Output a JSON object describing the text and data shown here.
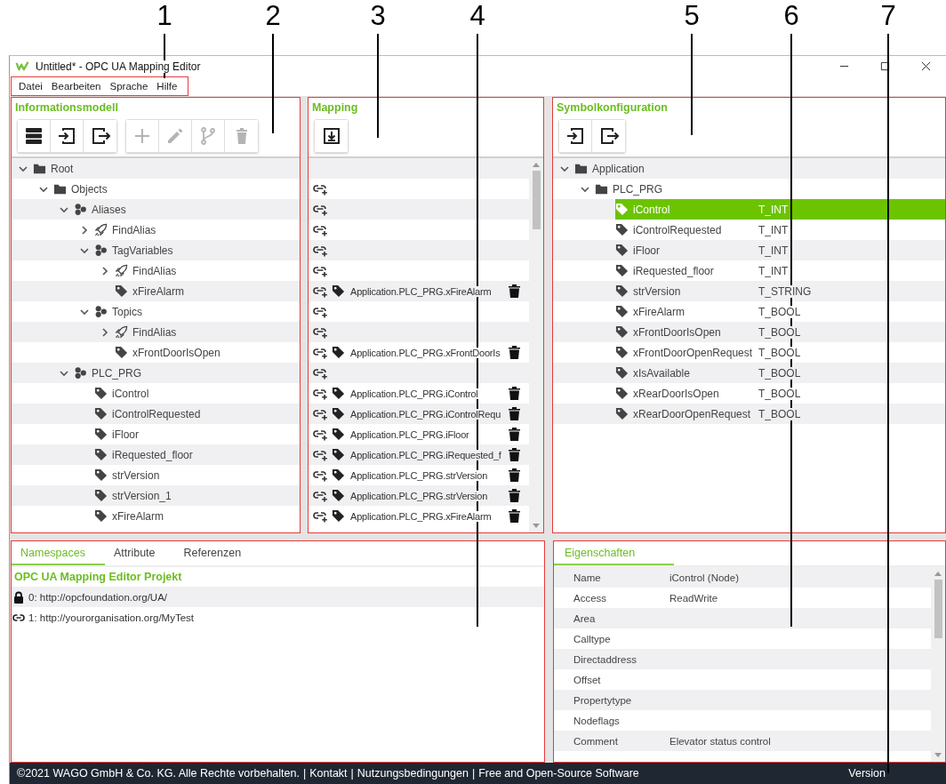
{
  "window": {
    "title": "Untitled* - OPC UA Mapping Editor"
  },
  "callouts": [
    {
      "number": "1"
    },
    {
      "number": "2"
    },
    {
      "number": "3"
    },
    {
      "number": "4"
    },
    {
      "number": "5"
    },
    {
      "number": "6"
    },
    {
      "number": "7"
    }
  ],
  "menu": [
    "Datei",
    "Bearbeiten",
    "Sprache",
    "Hilfe"
  ],
  "information_model": {
    "title": "Informationsmodell",
    "toolbar_groups": [
      [
        {
          "kind": "server",
          "disabled": false
        },
        {
          "kind": "import",
          "disabled": false
        },
        {
          "kind": "export",
          "disabled": false
        }
      ],
      [
        {
          "kind": "add",
          "disabled": true
        },
        {
          "kind": "edit",
          "disabled": true
        },
        {
          "kind": "branch",
          "disabled": true
        },
        {
          "kind": "delete",
          "disabled": true
        }
      ]
    ],
    "tree": [
      {
        "label": "Root",
        "kind": "folder",
        "expanded": true,
        "children": [
          {
            "label": "Objects",
            "kind": "folder",
            "expanded": true,
            "children": [
              {
                "label": "Aliases",
                "kind": "cluster",
                "expanded": true,
                "children": [
                  {
                    "label": "FindAlias",
                    "kind": "rocket",
                    "expanded": false
                  },
                  {
                    "label": "TagVariables",
                    "kind": "cluster",
                    "expanded": true,
                    "children": [
                      {
                        "label": "FindAlias",
                        "kind": "rocket",
                        "expanded": false
                      },
                      {
                        "label": "xFireAlarm",
                        "kind": "tag"
                      }
                    ]
                  },
                  {
                    "label": "Topics",
                    "kind": "cluster",
                    "expanded": true,
                    "children": [
                      {
                        "label": "FindAlias",
                        "kind": "rocket",
                        "expanded": false
                      },
                      {
                        "label": "xFrontDoorIsOpen",
                        "kind": "tag"
                      }
                    ]
                  }
                ]
              },
              {
                "label": "PLC_PRG",
                "kind": "cluster",
                "expanded": true,
                "children": [
                  {
                    "label": "iControl",
                    "kind": "tag"
                  },
                  {
                    "label": "iControlRequested",
                    "kind": "tag"
                  },
                  {
                    "label": "iFloor",
                    "kind": "tag"
                  },
                  {
                    "label": "iRequested_floor",
                    "kind": "tag"
                  },
                  {
                    "label": "strVersion",
                    "kind": "tag"
                  },
                  {
                    "label": "strVersion_1",
                    "kind": "tag"
                  },
                  {
                    "label": "xFireAlarm",
                    "kind": "tag"
                  }
                ]
              }
            ]
          }
        ]
      }
    ]
  },
  "mapping": {
    "title": "Mapping",
    "toolbar_groups": [
      [
        {
          "kind": "download",
          "disabled": false
        }
      ]
    ],
    "rows": [
      {
        "kind": "empty"
      },
      {
        "kind": "empty"
      },
      {
        "kind": "empty"
      },
      {
        "kind": "empty"
      },
      {
        "kind": "empty"
      },
      {
        "kind": "mapped",
        "target": "Application.PLC_PRG.xFireAlarm"
      },
      {
        "kind": "empty"
      },
      {
        "kind": "empty"
      },
      {
        "kind": "mapped",
        "target": "Application.PLC_PRG.xFrontDoorIs"
      },
      {
        "kind": "empty"
      },
      {
        "kind": "mapped",
        "target": "Application.PLC_PRG.iControl"
      },
      {
        "kind": "mapped",
        "target": "Application.PLC_PRG.iControlRequ"
      },
      {
        "kind": "mapped",
        "target": "Application.PLC_PRG.iFloor"
      },
      {
        "kind": "mapped",
        "target": "Application.PLC_PRG.iRequested_f"
      },
      {
        "kind": "mapped",
        "target": "Application.PLC_PRG.strVersion"
      },
      {
        "kind": "mapped",
        "target": "Application.PLC_PRG.strVersion"
      },
      {
        "kind": "mapped",
        "target": "Application.PLC_PRG.xFireAlarm"
      }
    ]
  },
  "symbols": {
    "title": "Symbolkonfiguration",
    "toolbar_groups": [
      [
        {
          "kind": "import",
          "disabled": false
        },
        {
          "kind": "export",
          "disabled": false
        }
      ]
    ],
    "tree": [
      {
        "label": "Application",
        "kind": "folder",
        "expanded": true,
        "selected": false,
        "children": [
          {
            "label": "PLC_PRG",
            "kind": "folder",
            "expanded": true,
            "selected": false,
            "children": [
              {
                "label": "iControl",
                "kind": "tag",
                "type": "T_INT",
                "selected": true
              },
              {
                "label": "iControlRequested",
                "kind": "tag",
                "type": "T_INT",
                "selected": false
              },
              {
                "label": "iFloor",
                "kind": "tag",
                "type": "T_INT",
                "selected": false
              },
              {
                "label": "iRequested_floor",
                "kind": "tag",
                "type": "T_INT",
                "selected": false
              },
              {
                "label": "strVersion",
                "kind": "tag",
                "type": "T_STRING",
                "selected": false
              },
              {
                "label": "xFireAlarm",
                "kind": "tag",
                "type": "T_BOOL",
                "selected": false
              },
              {
                "label": "xFrontDoorIsOpen",
                "kind": "tag",
                "type": "T_BOOL",
                "selected": false
              },
              {
                "label": "xFrontDoorOpenRequest",
                "kind": "tag",
                "type": "T_BOOL",
                "selected": false
              },
              {
                "label": "xIsAvailable",
                "kind": "tag",
                "type": "T_BOOL",
                "selected": false
              },
              {
                "label": "xRearDoorIsOpen",
                "kind": "tag",
                "type": "T_BOOL",
                "selected": false
              },
              {
                "label": "xRearDoorOpenRequest",
                "kind": "tag",
                "type": "T_BOOL",
                "selected": false
              }
            ]
          }
        ]
      }
    ]
  },
  "namespaces_panel": {
    "tabs": [
      {
        "label": "Namespaces",
        "selected": true
      },
      {
        "label": "Attribute",
        "selected": false
      },
      {
        "label": "Referenzen",
        "selected": false
      }
    ],
    "heading": "OPC UA Mapping Editor Projekt",
    "namespaces": [
      {
        "kind": "locked",
        "text": "0: http://opcfoundation.org/UA/"
      },
      {
        "kind": "linked",
        "text": "1: http://yourorganisation.org/MyTest"
      }
    ]
  },
  "properties_panel": {
    "tabs": [
      {
        "label": "Eigenschaften",
        "selected": true
      }
    ],
    "rows": [
      {
        "name": "Name",
        "value": "iControl (Node)"
      },
      {
        "name": "Access",
        "value": "ReadWrite"
      },
      {
        "name": "Area"
      },
      {
        "name": "Calltype"
      },
      {
        "name": "Directaddress"
      },
      {
        "name": "Offset"
      },
      {
        "name": "Propertytype"
      },
      {
        "name": "Nodeflags"
      },
      {
        "name": "Comment",
        "value": "Elevator status control"
      }
    ]
  },
  "status_bar": {
    "copyright": "©2021 WAGO GmbH & Co. KG. Alle Rechte vorbehalten.",
    "separator": "|",
    "links": [
      "Kontakt",
      "Nutzungsbedingungen",
      "Free and Open-Source Software"
    ],
    "version": "Version"
  }
}
